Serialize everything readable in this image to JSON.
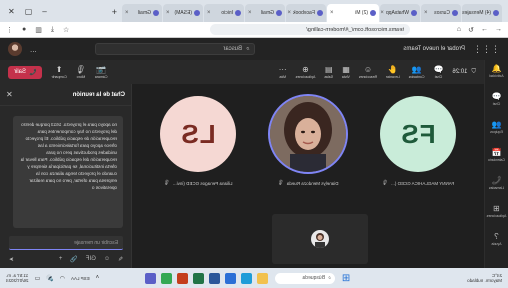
{
  "browser": {
    "tabs": [
      {
        "label": "(4) Mensajes",
        "active": false
      },
      {
        "label": "Cursos",
        "active": false
      },
      {
        "label": "WhatsApp",
        "active": false
      },
      {
        "label": "(2) Mi",
        "active": true
      },
      {
        "label": "Facebook",
        "active": false
      },
      {
        "label": "Gmail",
        "active": false
      },
      {
        "label": "Inicio",
        "active": false
      },
      {
        "label": "(ESAM)",
        "active": false
      },
      {
        "label": "Gmail",
        "active": false
      }
    ],
    "new_tab_glyph": "+",
    "url": "teams.microsoft.com/_#/modern-calling/"
  },
  "teams": {
    "app_name": "Probar el nuevo Teams",
    "search_placeholder": "Buscar",
    "more_glyph": "...",
    "rail": [
      {
        "icon": "bell-icon",
        "glyph": "🔔",
        "label": "Actividad"
      },
      {
        "icon": "chat-icon",
        "glyph": "💬",
        "label": "Chat"
      },
      {
        "icon": "teams-icon",
        "glyph": "👥",
        "label": "Equipos"
      },
      {
        "icon": "calendar-icon",
        "glyph": "📅",
        "label": "Calendario"
      },
      {
        "icon": "calls-icon",
        "glyph": "📞",
        "label": "Llamadas"
      },
      {
        "icon": "apps-icon",
        "glyph": "⊞",
        "label": "Aplicaciones"
      },
      {
        "icon": "help-icon",
        "glyph": "?",
        "label": "Ayuda"
      }
    ]
  },
  "meeting": {
    "timer": "10:26",
    "tools": [
      {
        "icon": "chat-icon",
        "glyph": "💬",
        "label": "Chat",
        "active": true
      },
      {
        "icon": "people-icon",
        "glyph": "👥",
        "label": "Contactos"
      },
      {
        "icon": "hand-icon",
        "glyph": "✋",
        "label": "Levantar"
      },
      {
        "icon": "react-icon",
        "glyph": "☺",
        "label": "Reacciones"
      },
      {
        "icon": "view-icon",
        "glyph": "▦",
        "label": "Vista"
      },
      {
        "icon": "rooms-icon",
        "glyph": "▤",
        "label": "Salas"
      },
      {
        "icon": "apps-icon",
        "glyph": "⊕",
        "label": "Aplicaciones"
      },
      {
        "icon": "more-icon",
        "glyph": "···",
        "label": "Más"
      }
    ],
    "devices": [
      {
        "icon": "camera-icon",
        "glyph": "📷",
        "label": "Cámara"
      },
      {
        "icon": "mic-icon",
        "glyph": "🎙",
        "label": "Micro"
      },
      {
        "icon": "share-icon",
        "glyph": "⬆",
        "label": "Compartir"
      }
    ],
    "leave_label": "Salir",
    "participants": [
      {
        "initials": "FS",
        "name": "FANNY MAGLAHICA GCED (...",
        "bg": "#c9ecd9",
        "fg": "#1e5a3a"
      },
      {
        "initials": "",
        "name": "Dianelys Mendoza Rueda",
        "bg": "#6b5a52",
        "fg": "#ffffff"
      },
      {
        "initials": "LS",
        "name": "Liliana Penagos GCED (invi...",
        "bg": "#f5d8d3",
        "fg": "#7a2b22"
      }
    ],
    "mic_glyph": "🎙"
  },
  "chat": {
    "title": "Chat de la reunión",
    "close_glyph": "✕",
    "message": "no apoyo para el proyecto. 1613 porque dentro del proyecto no hay componentes para recuperación de espacio público. El proyecto ofrece apoyo para fortalecimiento a las unidades productivas pero no para recuperación del espacio público. Para llevar la oferta institucional, se participaría siempre y cuando el proyecto tenga alianza con la empresa para ofertar, pero no para realizar operativos o",
    "input_placeholder": "Escribir un mensaje",
    "tools": [
      "✎",
      "☺",
      "GIF",
      "📎",
      "+"
    ],
    "send_glyph": "➤"
  },
  "taskbar": {
    "weather_temp": "24°C",
    "weather_desc": "Mayorm. nublado",
    "search_placeholder": "Búsqueda",
    "apps": [
      {
        "icon": "explorer-icon",
        "color": "#f2c14e"
      },
      {
        "icon": "edge-icon",
        "color": "#1f9cd8"
      },
      {
        "icon": "store-icon",
        "color": "#2b6fd6"
      },
      {
        "icon": "word-icon",
        "color": "#2b579a"
      },
      {
        "icon": "excel-icon",
        "color": "#217346"
      },
      {
        "icon": "powerpoint-icon",
        "color": "#c43e1c"
      },
      {
        "icon": "chrome-icon",
        "color": "#34a853"
      },
      {
        "icon": "teams-icon",
        "color": "#5b5fc7"
      }
    ],
    "lang": "ESP LAA",
    "time": "11:57 a. m.",
    "date": "26/07/2024"
  }
}
